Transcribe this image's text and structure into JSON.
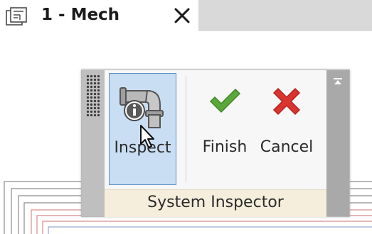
{
  "tab": {
    "title": "1 - Mech",
    "icon": "floor-plan-view-icon",
    "close_icon": "close-icon"
  },
  "panel": {
    "title": "System Inspector",
    "buttons": [
      {
        "label": "Inspect",
        "icon": "inspect-pipe-icon",
        "state": "active"
      },
      {
        "label": "Finish",
        "icon": "checkmark-icon"
      },
      {
        "label": "Cancel",
        "icon": "cancel-x-icon"
      }
    ]
  },
  "colors": {
    "active_button_bg": "#c9def2",
    "active_button_border": "#5b8fc5",
    "finish_green": "#5aa83a",
    "cancel_red": "#d9342f",
    "footer_bg": "#f5eedc",
    "drawing_red": "#d88c8c",
    "drawing_blue": "#9aa8d8"
  }
}
